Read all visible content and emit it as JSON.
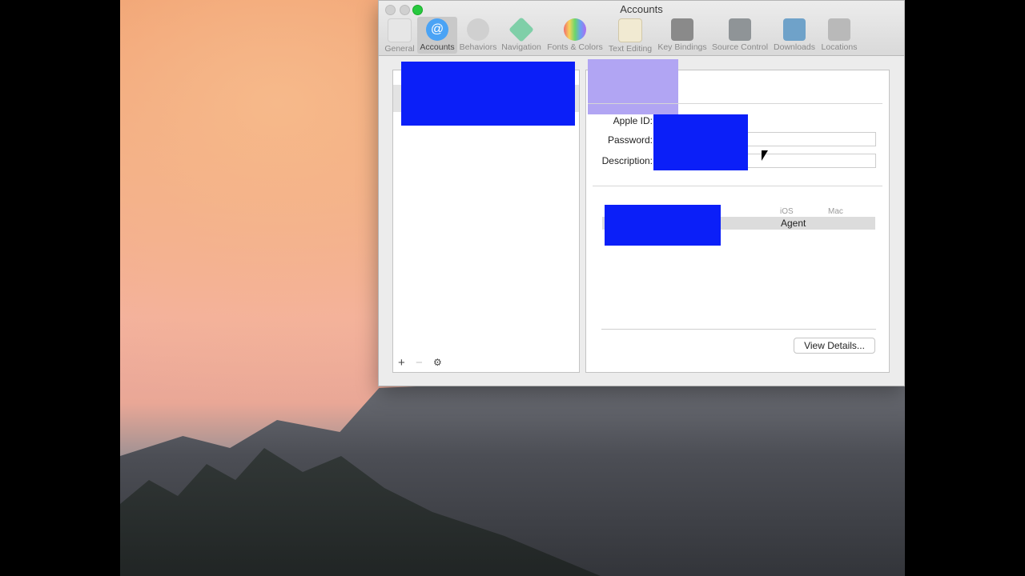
{
  "window": {
    "title": "Accounts"
  },
  "toolbar": {
    "items": [
      {
        "label": "General",
        "icon": "general-switch-icon",
        "color": "#d8d8d8"
      },
      {
        "label": "Accounts",
        "icon": "at-sign-icon",
        "color": "#4aa3f5",
        "active": true
      },
      {
        "label": "Behaviors",
        "icon": "gears-icon",
        "color": "#c7c7c7"
      },
      {
        "label": "Navigation",
        "icon": "navigation-arrows-icon",
        "color": "#7fcfa8"
      },
      {
        "label": "Fonts & Colors",
        "icon": "fonts-colors-icon",
        "color": "#9a7bd0"
      },
      {
        "label": "Text Editing",
        "icon": "text-editing-icon",
        "color": "#e7dfc6"
      },
      {
        "label": "Key Bindings",
        "icon": "keyboard-icon",
        "color": "#8a8a8a"
      },
      {
        "label": "Source Control",
        "icon": "source-control-icon",
        "color": "#8f9497"
      },
      {
        "label": "Downloads",
        "icon": "downloads-icon",
        "color": "#6fa2c9"
      },
      {
        "label": "Locations",
        "icon": "locations-icon",
        "color": "#b9b9b9"
      }
    ]
  },
  "accounts_list": {
    "controls": {
      "add": "+",
      "remove": "−",
      "settings": "⚙"
    }
  },
  "details": {
    "apple_id_label": "Apple ID:",
    "password_label": "Password:",
    "description_label": "Description:",
    "teams_columns": {
      "ios": "iOS",
      "mac": "Mac"
    },
    "team_role": "Agent",
    "view_details_label": "View Details..."
  },
  "colors": {
    "redaction": "#0b1ff8",
    "redaction_light": "#b1a5f3"
  }
}
